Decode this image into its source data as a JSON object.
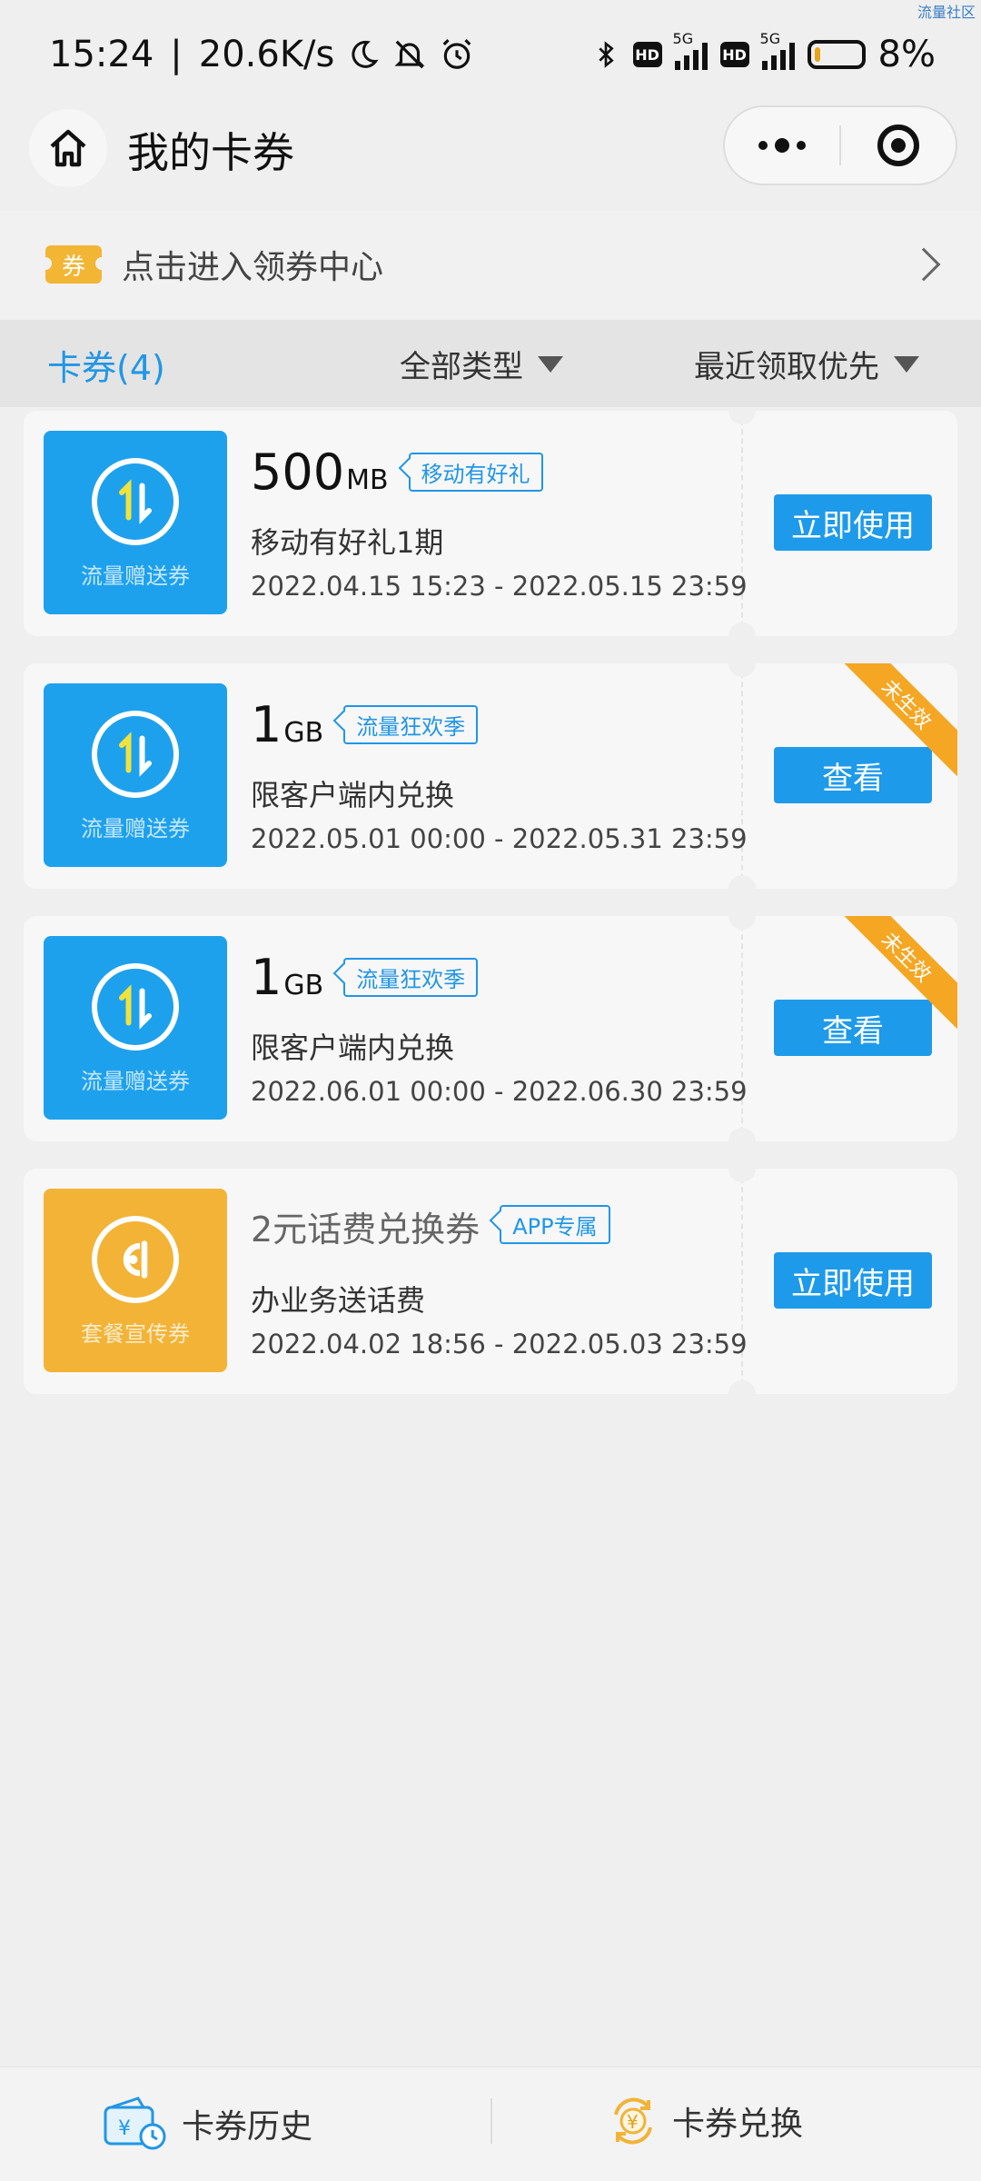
{
  "status_bar": {
    "time": "15:24",
    "separator": "|",
    "speed": "20.6K/s",
    "hd1": "HD",
    "sig1": "5G",
    "hd2": "HD",
    "sig2": "5G",
    "battery": "8%",
    "watermark": "流量社区"
  },
  "header": {
    "title": "我的卡券"
  },
  "banner": {
    "icon_text": "券",
    "text": "点击进入领券中心"
  },
  "filters": {
    "count_label": "卡券(4)",
    "type_filter": "全部类型",
    "sort_filter": "最近领取优先"
  },
  "coupons": [
    {
      "thumb_label": "流量赠送券",
      "amount": "500",
      "unit": "MB",
      "tag": "移动有好礼",
      "desc": "移动有好礼1期",
      "dates": "2022.04.15 15:23 - 2022.05.15 23:59",
      "action": "立即使用",
      "ribbon": ""
    },
    {
      "thumb_label": "流量赠送券",
      "amount": "1",
      "unit": "GB",
      "tag": "流量狂欢季",
      "desc": "限客户端内兑换",
      "dates": "2022.05.01 00:00 - 2022.05.31 23:59",
      "action": "查看",
      "ribbon": "未生效"
    },
    {
      "thumb_label": "流量赠送券",
      "amount": "1",
      "unit": "GB",
      "tag": "流量狂欢季",
      "desc": "限客户端内兑换",
      "dates": "2022.06.01 00:00 - 2022.06.30 23:59",
      "action": "查看",
      "ribbon": "未生效"
    },
    {
      "thumb_label": "套餐宣传券",
      "title": "2元话费兑换券",
      "tag": "APP专属",
      "desc": "办业务送话费",
      "dates": "2022.04.02 18:56 - 2022.05.03 23:59",
      "action": "立即使用",
      "ribbon": ""
    }
  ],
  "bottom_nav": {
    "history": "卡券历史",
    "exchange": "卡券兑换"
  },
  "colors": {
    "accent": "#1e9aea",
    "gold": "#f2b336",
    "ribbon": "#f5a623"
  }
}
